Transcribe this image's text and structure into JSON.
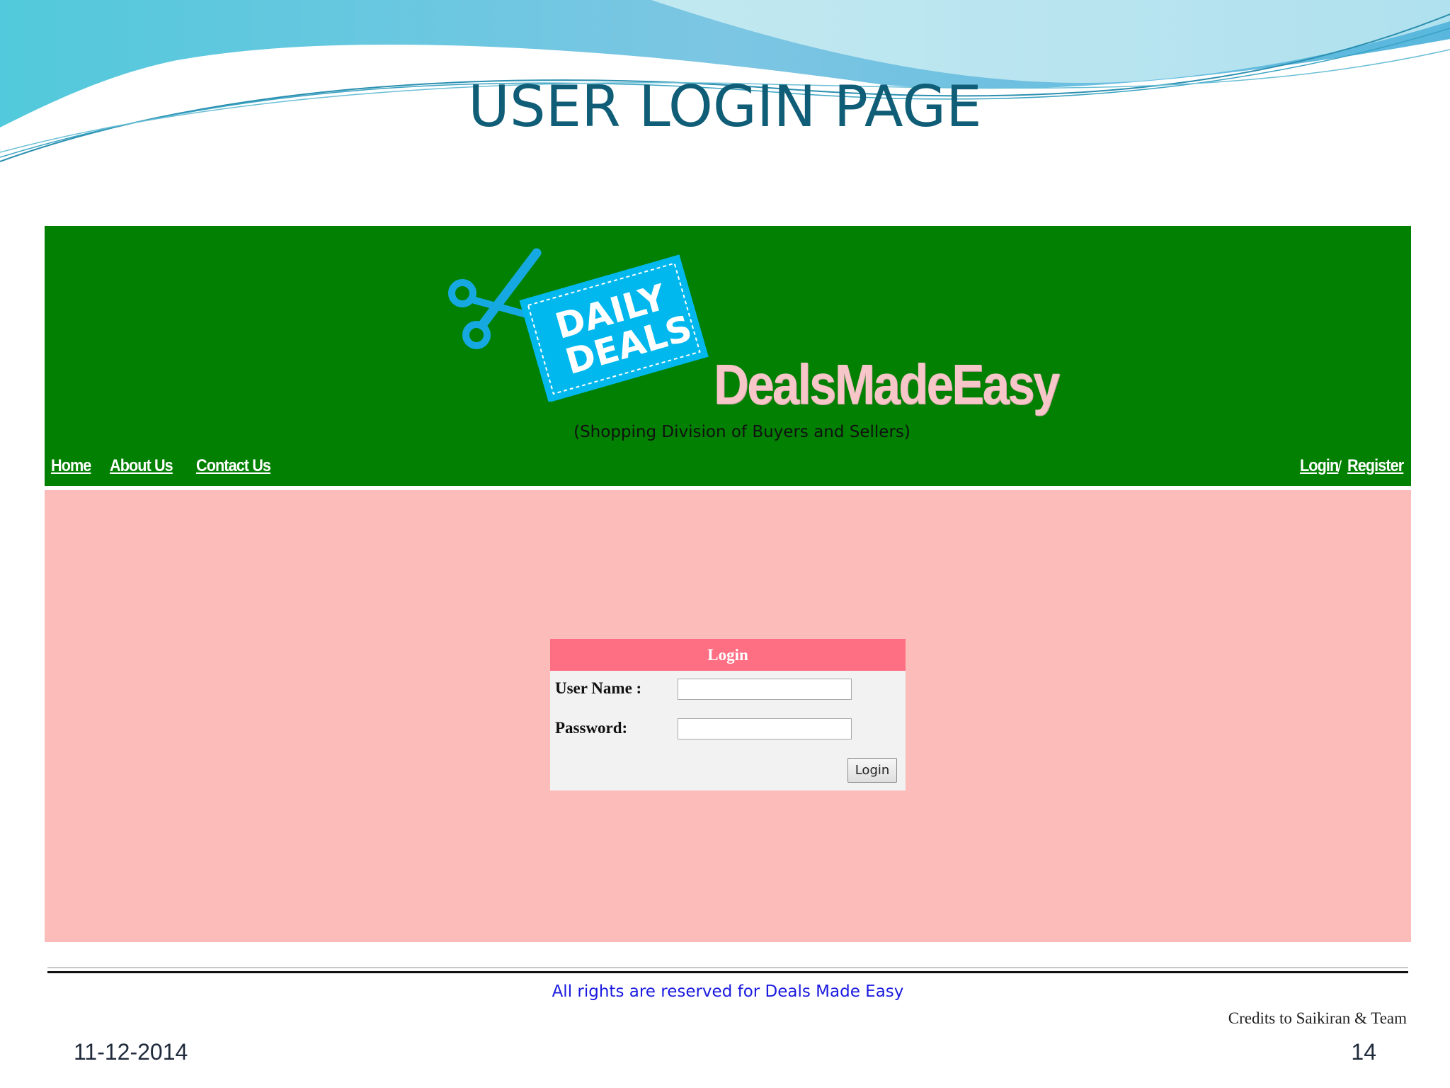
{
  "slide": {
    "title": "USER LOGIN PAGE",
    "date": "11-12-2014",
    "page_number": "14"
  },
  "site": {
    "logo_text_line1": "DAILY",
    "logo_text_line2": "DEALS",
    "brand_name": "DealsMadeEasy",
    "tagline": "(Shopping Division of Buyers and Sellers)",
    "nav": {
      "home": "Home",
      "about": "About Us",
      "contact": "Contact Us",
      "login": "Login",
      "separator": "/",
      "register": "Register"
    },
    "colors": {
      "header_bg": "#028002",
      "content_bg": "#fbbcba",
      "login_header_bg": "#ff6f84",
      "brand_text": "#f7c6c8",
      "logo_tag": "#00b8ee"
    }
  },
  "login_form": {
    "title": "Login",
    "username_label": "User Name :",
    "username_value": "",
    "password_label": "Password:",
    "password_value": "",
    "submit_label": "Login"
  },
  "footer": {
    "copyright": "All rights are reserved for Deals Made Easy",
    "credits": "Credits to Saikiran & Team"
  }
}
